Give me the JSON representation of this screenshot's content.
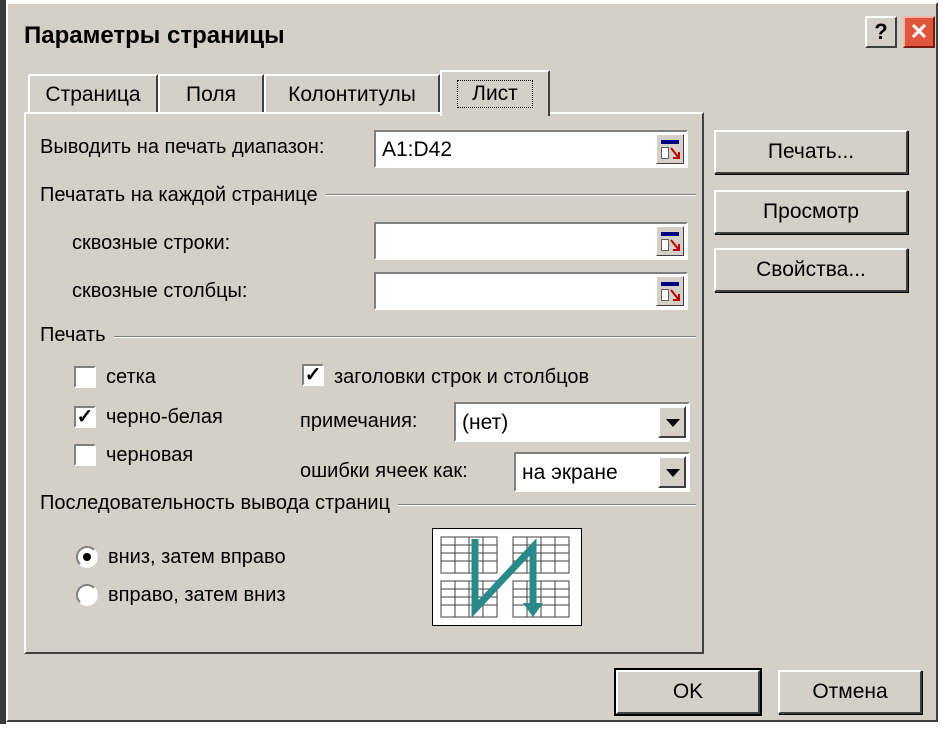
{
  "window": {
    "title": "Параметры страницы",
    "help_label": "?",
    "close_label": "✕"
  },
  "tabs": [
    {
      "label": "Страница",
      "active": false
    },
    {
      "label": "Поля",
      "active": false
    },
    {
      "label": "Колонтитулы",
      "active": false
    },
    {
      "label": "Лист",
      "active": true
    }
  ],
  "print_area": {
    "label": "Выводить на печать диапазон:",
    "value": "A1:D42"
  },
  "print_titles": {
    "group_label": "Печатать на каждой странице",
    "rows_label": "сквозные строки:",
    "rows_value": "",
    "cols_label": "сквозные столбцы:",
    "cols_value": ""
  },
  "print": {
    "group_label": "Печать",
    "gridlines": {
      "label": "сетка",
      "checked": false
    },
    "black_white": {
      "label": "черно-белая",
      "checked": true
    },
    "draft": {
      "label": "черновая",
      "checked": false
    },
    "headings": {
      "label": "заголовки строк и столбцов",
      "checked": true
    },
    "comments_label": "примечания:",
    "comments_value": "(нет)",
    "errors_label": "ошибки ячеек как:",
    "errors_value": "на экране"
  },
  "page_order": {
    "group_label": "Последовательность вывода страниц",
    "down_then_over": {
      "label": "вниз, затем вправо",
      "selected": true
    },
    "over_then_down": {
      "label": "вправо, затем вниз",
      "selected": false
    }
  },
  "buttons": {
    "print": "Печать...",
    "preview": "Просмотр",
    "options": "Свойства...",
    "ok": "OK",
    "cancel": "Отмена"
  },
  "colors": {
    "face": "#d4d0c8",
    "close": "#e0563c",
    "order_arrow": "#2a8a8a"
  }
}
